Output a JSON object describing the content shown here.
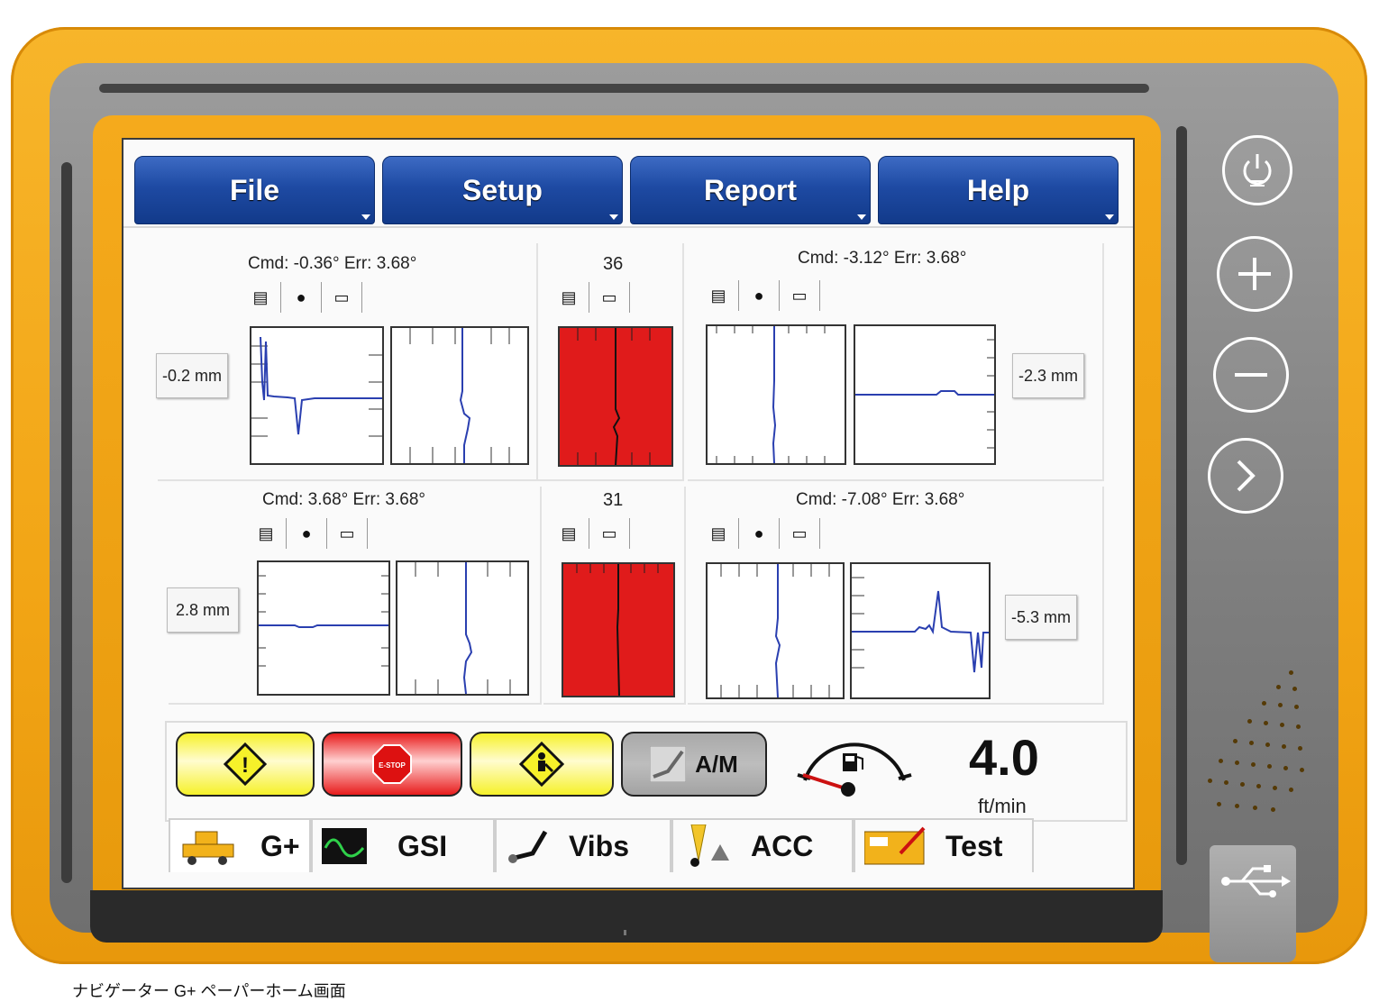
{
  "menu": {
    "items": [
      "File",
      "Setup",
      "Report",
      "Help"
    ]
  },
  "panels": {
    "top_left": {
      "cmd": "Cmd: -0.36° Err: 3.68°",
      "offset": "-0.2 mm"
    },
    "top_center": {
      "value": "36"
    },
    "top_right": {
      "cmd": "Cmd: -3.12° Err: 3.68°",
      "offset": "-2.3 mm"
    },
    "bottom_left": {
      "cmd": "Cmd: 3.68° Err: 3.68°",
      "offset": "2.8 mm"
    },
    "bottom_center": {
      "value": "31"
    },
    "bottom_right": {
      "cmd": "Cmd: -7.08° Err: 3.68°",
      "offset": "-5.3 mm"
    }
  },
  "status": {
    "estop_label": "E-STOP",
    "am_label": "A/M",
    "speed_value": "4.0",
    "speed_unit": "ft/min"
  },
  "tabs": [
    "G+",
    "GSI",
    "Vibs",
    "ACC",
    "Test"
  ],
  "caption": "ナビゲーター G+ ペーパーホーム画面",
  "colors": {
    "bezel": "#f2a515",
    "menu_blue": "#1e4aa3",
    "gauge_red": "#e01b1b",
    "warning_yellow": "#f6f12a"
  },
  "icons": [
    "power-icon",
    "plus-icon",
    "minus-icon",
    "chevron-right-icon",
    "usb-icon"
  ]
}
